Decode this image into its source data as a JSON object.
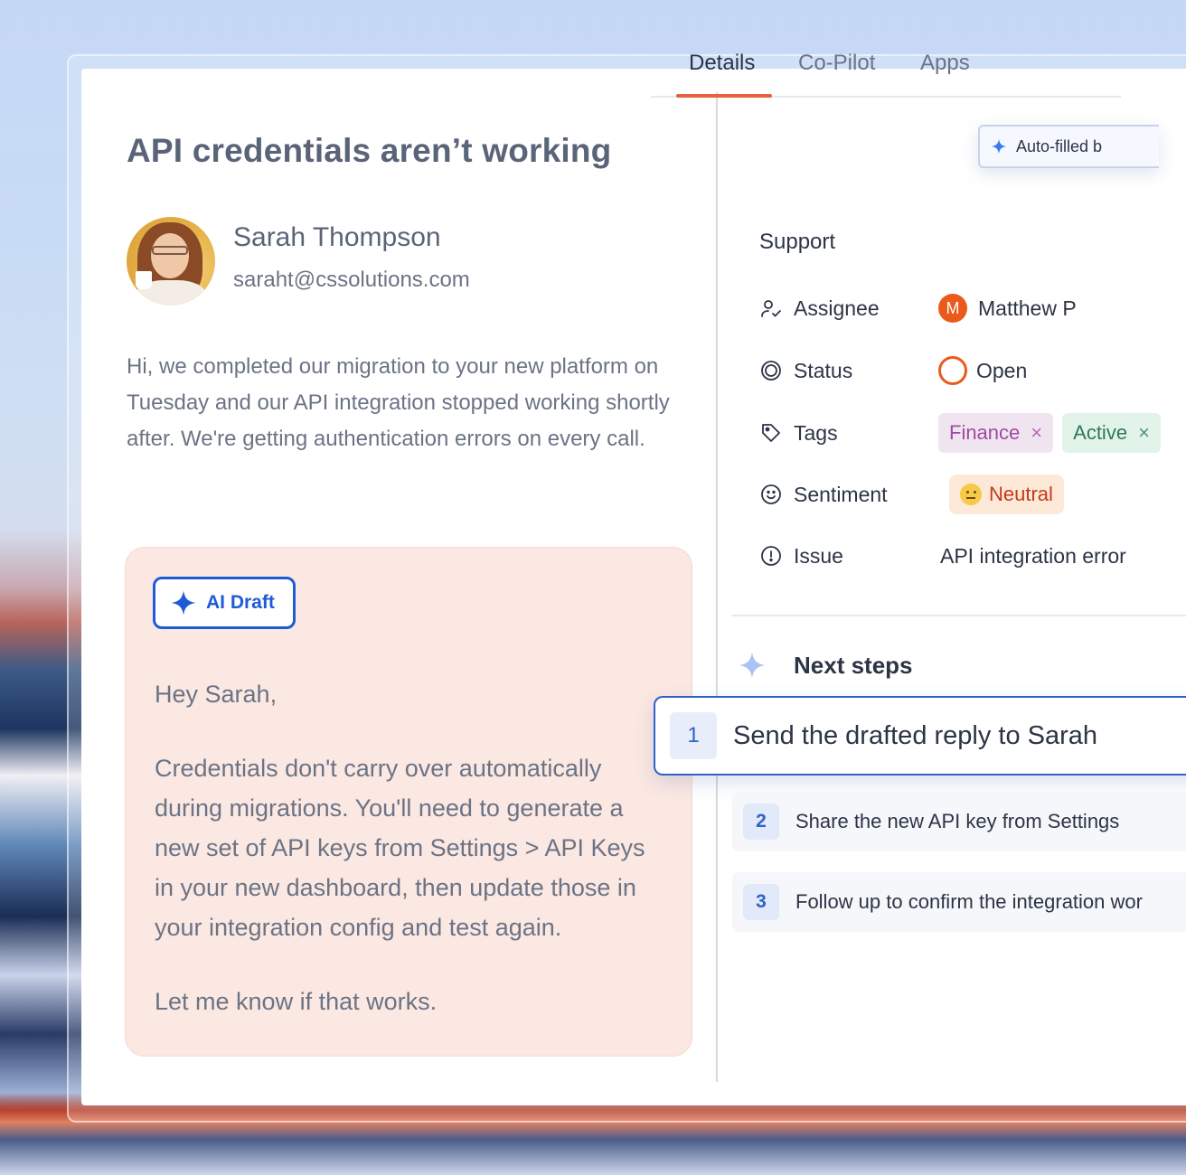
{
  "ticket": {
    "title": "API credentials aren’t working",
    "sender_name": "Sarah Thompson",
    "sender_email": "saraht@cssolutions.com",
    "message": "Hi, we completed our migration to your new platform on Tuesday and our API integration stopped working shortly after. We're getting authentication errors on every call."
  },
  "draft": {
    "button_label": "AI Draft",
    "greeting": "Hey Sarah,",
    "body": "Credentials don't carry over automatically during migrations. You'll need to generate a new set of API keys from Settings > API Keys in your new dashboard, then update those in your integration config and test again.",
    "closing": "Let me know if that works."
  },
  "tabs": [
    {
      "label": "Details",
      "active": true
    },
    {
      "label": "Co-Pilot",
      "active": false
    },
    {
      "label": "Apps",
      "active": false
    }
  ],
  "autofill": {
    "label": "Auto-filled b"
  },
  "details": {
    "section": "Support",
    "assignee": {
      "label": "Assignee",
      "initial": "M",
      "name": "Matthew P"
    },
    "status": {
      "label": "Status",
      "value": "Open"
    },
    "tags": {
      "label": "Tags",
      "items": [
        "Finance",
        "Active"
      ],
      "remove_glyph": "×"
    },
    "sentiment": {
      "label": "Sentiment",
      "value": "Neutral"
    },
    "issue": {
      "label": "Issue",
      "value": "API integration error"
    }
  },
  "next_steps": {
    "title": "Next steps",
    "items": [
      {
        "num": "1",
        "text": "Send the drafted reply to Sarah"
      },
      {
        "num": "2",
        "text": "Share the new API key from Settings"
      },
      {
        "num": "3",
        "text": "Follow up to confirm the integration wor"
      }
    ]
  },
  "colors": {
    "accent_blue": "#1f5bd8",
    "tab_underline": "#e8603c",
    "assignee_orange": "#ea5a1b",
    "draft_bg": "#fbe8e2"
  },
  "icons": {
    "assignee": "user-check-icon",
    "status": "target-icon",
    "tags": "tag-icon",
    "sentiment": "smile-icon",
    "issue": "alert-circle-icon",
    "ai": "sparkle-icon"
  }
}
